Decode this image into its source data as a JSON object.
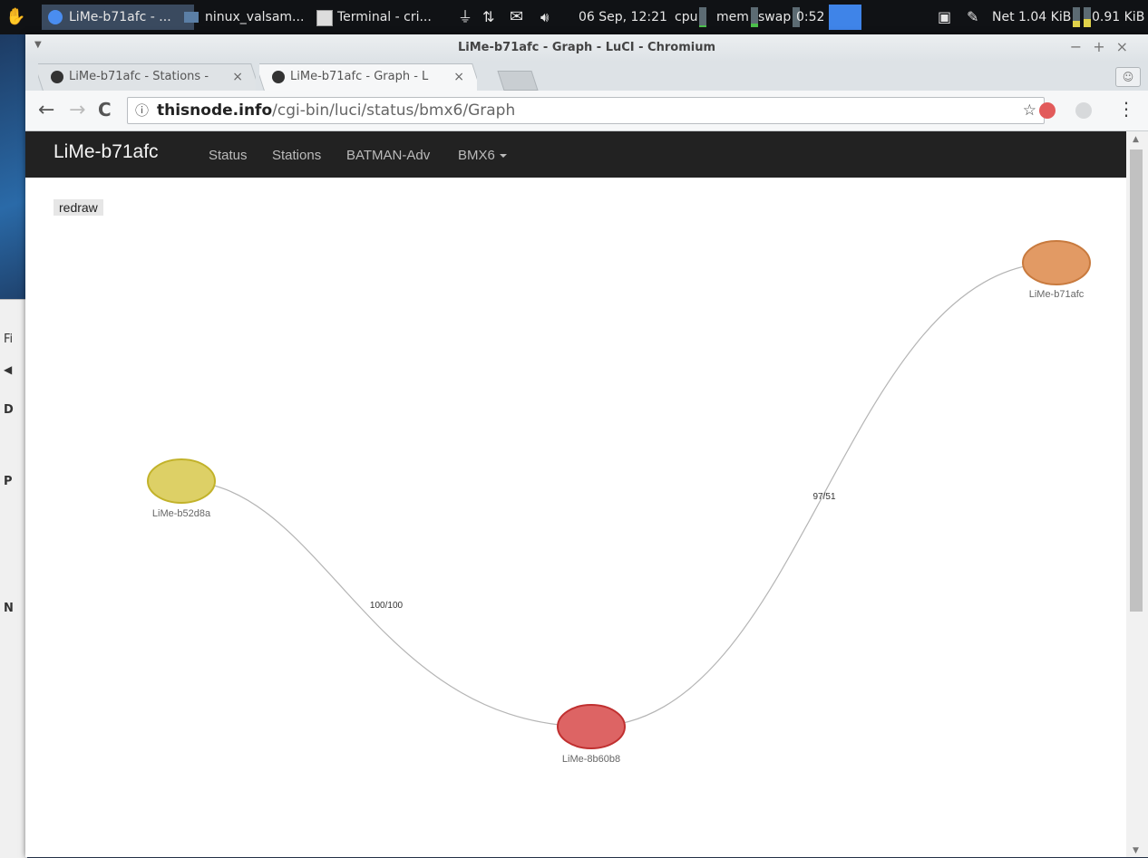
{
  "panel": {
    "tasks": [
      {
        "label": "LiMe-b71afc - ..."
      },
      {
        "label": "ninux_valsam..."
      },
      {
        "label": "Terminal - cri..."
      }
    ],
    "clock": "06 Sep, 12:21",
    "cpu_label": "cpu",
    "mem_label": "mem",
    "swap_label": "swap",
    "battery": "0:52",
    "net_label": "Net 1.04 KiB",
    "net_up": "0.91 KiB"
  },
  "behind": {
    "letters": [
      "Fi",
      "D",
      "P",
      "N"
    ]
  },
  "window": {
    "title": "LiMe-b71afc - Graph - LuCI - Chromium",
    "tabs": [
      {
        "label": "LiMe-b71afc - Stations -",
        "close": "×"
      },
      {
        "label": "LiMe-b71afc - Graph - L",
        "close": "×"
      }
    ],
    "url": {
      "info": "ⓘ",
      "host": "thisnode.info",
      "path": "/cgi-bin/luci/status/bmx6/Graph"
    }
  },
  "page": {
    "brand": "LiMe-b71afc",
    "nav": [
      "Status",
      "Stations",
      "BATMAN-Adv",
      "BMX6"
    ],
    "redraw": "redraw"
  },
  "graph": {
    "nodes": [
      {
        "id": "LiMe-b71afc",
        "color": "#e29a64",
        "stroke": "#c87a3e"
      },
      {
        "id": "LiMe-b52d8a",
        "color": "#ddd066",
        "stroke": "#c2b22a"
      },
      {
        "id": "LiMe-8b60b8",
        "color": "#dd6464",
        "stroke": "#c03030"
      }
    ],
    "edges": [
      {
        "from": "LiMe-b52d8a",
        "to": "LiMe-8b60b8",
        "label": "100/100"
      },
      {
        "from": "LiMe-8b60b8",
        "to": "LiMe-b71afc",
        "label": "97/51"
      }
    ]
  }
}
